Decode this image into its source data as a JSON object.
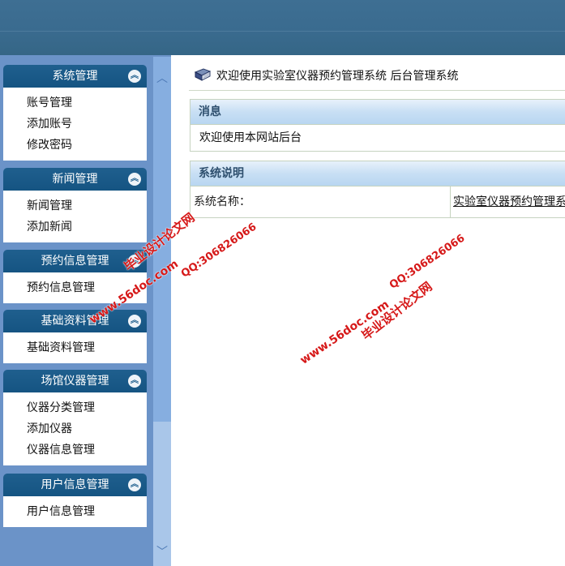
{
  "sidebar": {
    "groups": [
      {
        "title": "系统管理",
        "items": [
          "账号管理",
          "添加账号",
          "修改密码"
        ]
      },
      {
        "title": "新闻管理",
        "items": [
          "新闻管理",
          "添加新闻"
        ]
      },
      {
        "title": "预约信息管理",
        "items": [
          "预约信息管理"
        ]
      },
      {
        "title": "基础资料管理",
        "items": [
          "基础资料管理"
        ]
      },
      {
        "title": "场馆仪器管理",
        "items": [
          "仪器分类管理",
          "添加仪器",
          "仪器信息管理"
        ]
      },
      {
        "title": "用户信息管理",
        "items": [
          "用户信息管理"
        ]
      }
    ],
    "toggle_glyph": "︽",
    "scroll_up_glyph": "︿",
    "scroll_down_glyph": "﹀"
  },
  "main": {
    "welcome_text": "欢迎使用实验室仪器预约管理系统 后台管理系统",
    "message_panel": {
      "title": "消息",
      "body": "欢迎使用本网站后台"
    },
    "system_panel": {
      "title": "系统说明",
      "name_label": "系统名称：",
      "name_value": "实验室仪器预约管理系统"
    }
  },
  "watermarks": {
    "site_a": "www.56doc.com",
    "qq_a": "QQ:306826066",
    "brand_a": "毕业设计论文网",
    "site_b": "www.56doc.com",
    "qq_b": "QQ:306826066",
    "brand_b": "毕业设计论文网"
  },
  "colors": {
    "header_bg": "#3a6b8f",
    "sidebar_bg": "#6b93c8",
    "group_head_bg": "#1a5986",
    "panel_head_bg": "#c8dff4",
    "watermark": "#d61919"
  }
}
